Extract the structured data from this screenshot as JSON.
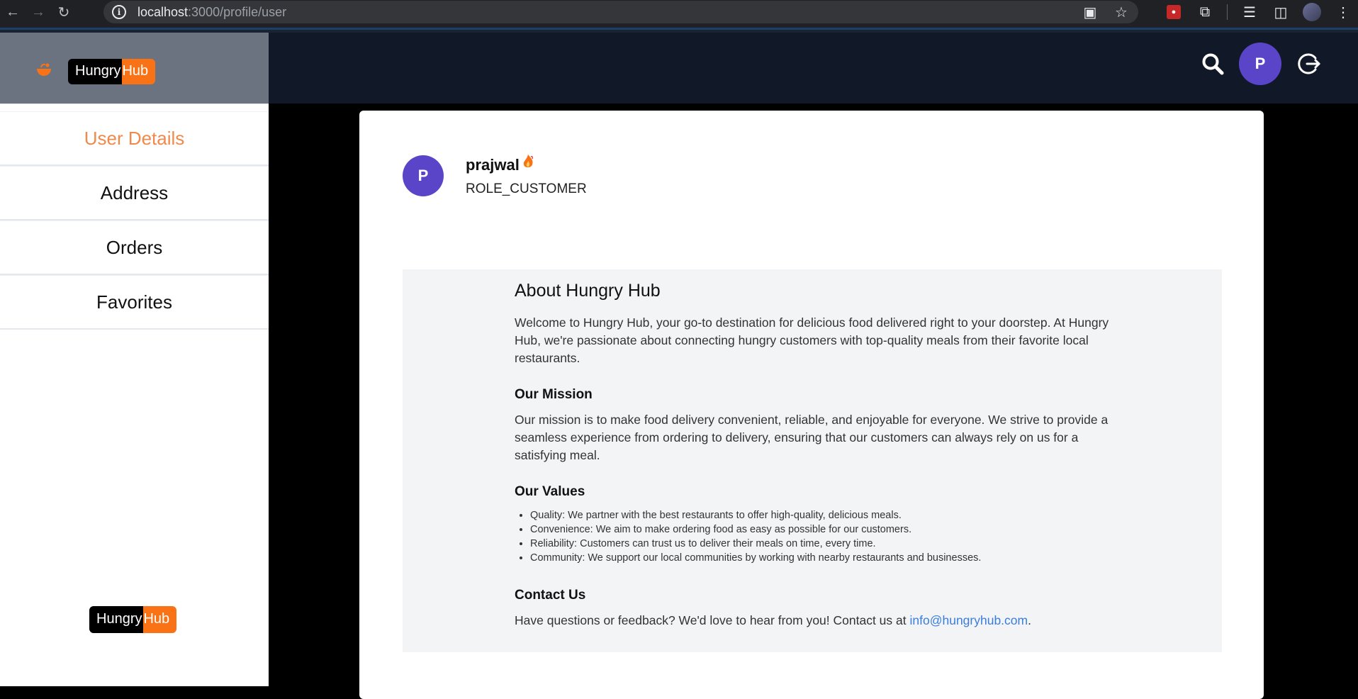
{
  "browser": {
    "url_host": "localhost",
    "url_path": ":3000/profile/user"
  },
  "brand": {
    "part1": "Hungry",
    "part2": "Hub",
    "accent": "#f97316"
  },
  "header": {
    "avatar_initial": "P"
  },
  "sidebar": {
    "items": [
      {
        "label": "User Details",
        "active": true
      },
      {
        "label": "Address"
      },
      {
        "label": "Orders"
      },
      {
        "label": "Favorites"
      }
    ]
  },
  "profile": {
    "initial": "P",
    "name": "prajwal",
    "role": "ROLE_CUSTOMER"
  },
  "about": {
    "title": "About Hungry Hub",
    "intro": "Welcome to Hungry Hub, your go-to destination for delicious food delivered right to your doorstep. At Hungry Hub, we're passionate about connecting hungry customers with top-quality meals from their favorite local restaurants.",
    "mission_title": "Our Mission",
    "mission_text": "Our mission is to make food delivery convenient, reliable, and enjoyable for everyone. We strive to provide a seamless experience from ordering to delivery, ensuring that our customers can always rely on us for a satisfying meal.",
    "values_title": "Our Values",
    "values": [
      "Quality: We partner with the best restaurants to offer high-quality, delicious meals.",
      "Convenience: We aim to make ordering food as easy as possible for our customers.",
      "Reliability: Customers can trust us to deliver their meals on time, every time.",
      "Community: We support our local communities by working with nearby restaurants and businesses."
    ],
    "contact_title": "Contact Us",
    "contact_text": "Have questions or feedback? We'd love to hear from you! Contact us at ",
    "contact_email": "info@hungryhub.com",
    "contact_end": "."
  }
}
